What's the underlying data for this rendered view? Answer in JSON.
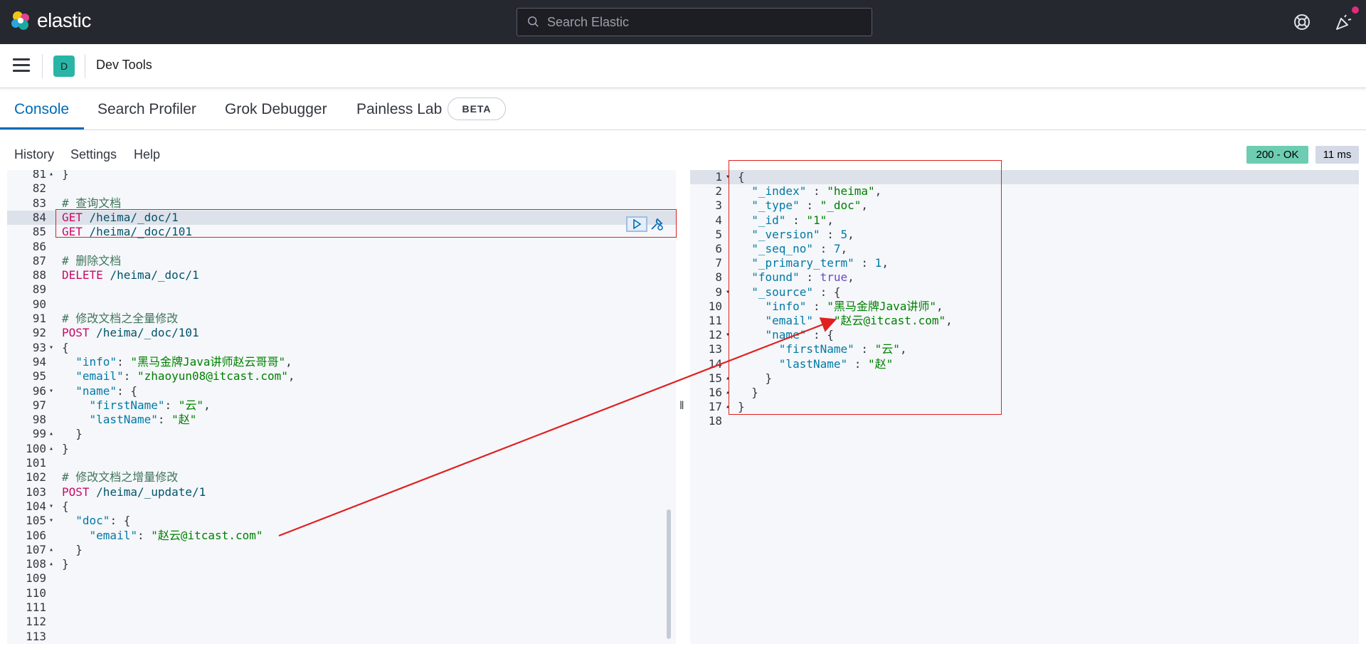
{
  "brand": {
    "name": "elastic"
  },
  "search": {
    "placeholder": "Search Elastic"
  },
  "header": {
    "space_letter": "D",
    "title": "Dev Tools"
  },
  "tabs": [
    {
      "label": "Console"
    },
    {
      "label": "Search Profiler"
    },
    {
      "label": "Grok Debugger"
    },
    {
      "label": "Painless Lab"
    }
  ],
  "beta_label": "BETA",
  "toolbar": {
    "history": "History",
    "settings": "Settings",
    "help": "Help"
  },
  "status": {
    "code": "200 - OK",
    "time": "11 ms"
  },
  "colors": {
    "accent": "#006bb8",
    "status_ok": "#6dccb1",
    "annotation": "#e02020"
  },
  "request_lines": [
    {
      "n": "81",
      "text": "}"
    },
    {
      "n": "82",
      "text": ""
    },
    {
      "n": "83",
      "text": "# 查询文档"
    },
    {
      "n": "84",
      "text": "GET /heima/_doc/1"
    },
    {
      "n": "85",
      "text": "GET /heima/_doc/101"
    },
    {
      "n": "86",
      "text": ""
    },
    {
      "n": "87",
      "text": "# 删除文档"
    },
    {
      "n": "88",
      "text": "DELETE /heima/_doc/1"
    },
    {
      "n": "89",
      "text": ""
    },
    {
      "n": "90",
      "text": ""
    },
    {
      "n": "91",
      "text": "# 修改文档之全量修改"
    },
    {
      "n": "92",
      "text": "POST /heima/_doc/101"
    },
    {
      "n": "93",
      "text": "{"
    },
    {
      "n": "94",
      "text": "  \"info\": \"黑马金牌Java讲师赵云哥哥\","
    },
    {
      "n": "95",
      "text": "  \"email\": \"zhaoyun08@itcast.com\","
    },
    {
      "n": "96",
      "text": "  \"name\": {"
    },
    {
      "n": "97",
      "text": "    \"firstName\": \"云\","
    },
    {
      "n": "98",
      "text": "    \"lastName\": \"赵\""
    },
    {
      "n": "99",
      "text": "  }"
    },
    {
      "n": "100",
      "text": "}"
    },
    {
      "n": "101",
      "text": ""
    },
    {
      "n": "102",
      "text": "# 修改文档之增量修改"
    },
    {
      "n": "103",
      "text": "POST /heima/_update/1"
    },
    {
      "n": "104",
      "text": "{"
    },
    {
      "n": "105",
      "text": "  \"doc\": {"
    },
    {
      "n": "106",
      "text": "    \"email\": \"赵云@itcast.com\""
    },
    {
      "n": "107",
      "text": "  }"
    },
    {
      "n": "108",
      "text": "}"
    },
    {
      "n": "109",
      "text": ""
    },
    {
      "n": "110",
      "text": ""
    },
    {
      "n": "111",
      "text": ""
    },
    {
      "n": "112",
      "text": ""
    },
    {
      "n": "113",
      "text": ""
    }
  ],
  "response_lines": [
    {
      "n": "1",
      "text": "{"
    },
    {
      "n": "2",
      "text": "  \"_index\" : \"heima\","
    },
    {
      "n": "3",
      "text": "  \"_type\" : \"_doc\","
    },
    {
      "n": "4",
      "text": "  \"_id\" : \"1\","
    },
    {
      "n": "5",
      "text": "  \"_version\" : 5,"
    },
    {
      "n": "6",
      "text": "  \"_seq_no\" : 7,"
    },
    {
      "n": "7",
      "text": "  \"_primary_term\" : 1,"
    },
    {
      "n": "8",
      "text": "  \"found\" : true,"
    },
    {
      "n": "9",
      "text": "  \"_source\" : {"
    },
    {
      "n": "10",
      "text": "    \"info\" : \"黑马金牌Java讲师\","
    },
    {
      "n": "11",
      "text": "    \"email\" : \"赵云@itcast.com\","
    },
    {
      "n": "12",
      "text": "    \"name\" : {"
    },
    {
      "n": "13",
      "text": "      \"firstName\" : \"云\","
    },
    {
      "n": "14",
      "text": "      \"lastName\" : \"赵\""
    },
    {
      "n": "15",
      "text": "    }"
    },
    {
      "n": "16",
      "text": "  }"
    },
    {
      "n": "17",
      "text": "}"
    },
    {
      "n": "18",
      "text": ""
    }
  ]
}
